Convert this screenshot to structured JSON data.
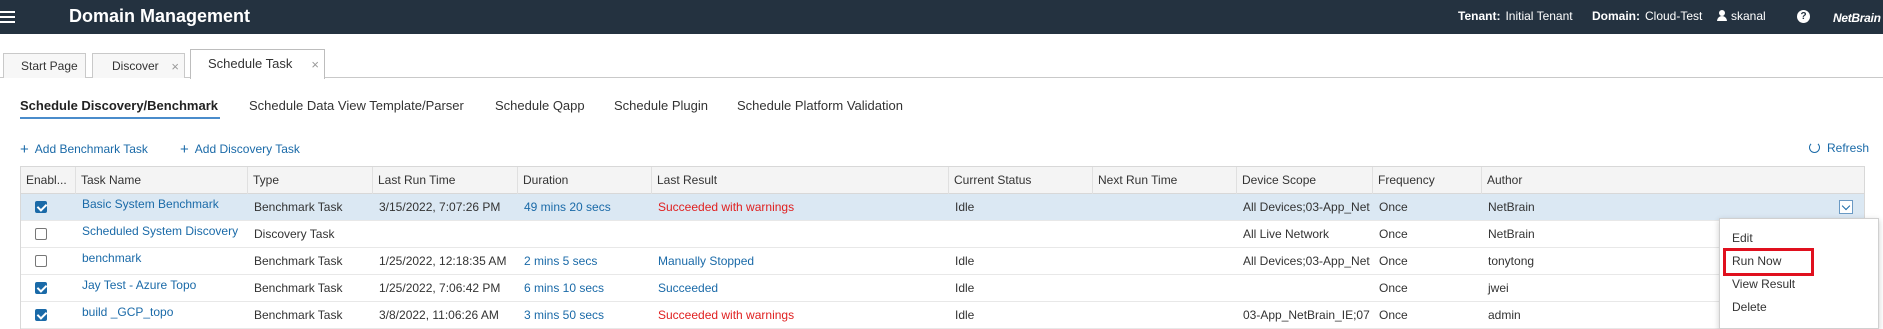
{
  "topbar": {
    "title": "Domain Management",
    "tenant_label": "Tenant:",
    "tenant_value": "Initial Tenant",
    "domain_label": "Domain:",
    "domain_value": "Cloud-Test",
    "user": "skanal",
    "help": "?",
    "logo": "NetBrain"
  },
  "page_tabs": [
    {
      "label": "Start Page"
    },
    {
      "label": "Discover",
      "close": "×"
    },
    {
      "label": "Schedule Task",
      "close": "×",
      "active": true
    }
  ],
  "sub_tabs": [
    {
      "label": "Schedule Discovery/Benchmark",
      "active": true
    },
    {
      "label": "Schedule Data View Template/Parser"
    },
    {
      "label": "Schedule Qapp"
    },
    {
      "label": "Schedule Plugin"
    },
    {
      "label": "Schedule Platform Validation"
    }
  ],
  "actions": {
    "add_benchmark": "Add Benchmark Task",
    "add_discovery": "Add Discovery Task",
    "plus": "+",
    "refresh": "Refresh"
  },
  "grid": {
    "columns": [
      "Enabl...",
      "Task Name",
      "Type",
      "Last Run Time",
      "Duration",
      "Last Result",
      "Current Status",
      "Next Run Time",
      "Device Scope",
      "Frequency",
      "Author"
    ],
    "rows": [
      {
        "enabled": true,
        "name": "Basic System Benchmark",
        "type": "Benchmark Task",
        "last_run": "3/15/2022, 7:07:26 PM",
        "duration": "49 mins 20 secs",
        "result": "Succeeded with warnings",
        "status": "Idle",
        "next_run": "",
        "scope": "All Devices;03-App_Net...",
        "frequency": "Once",
        "author": "NetBrain"
      },
      {
        "enabled": false,
        "name": "Scheduled System Discovery",
        "type": "Discovery Task",
        "last_run": "",
        "duration": "",
        "result": "",
        "status": "",
        "next_run": "",
        "scope": "All Live Network",
        "frequency": "Once",
        "author": "NetBrain"
      },
      {
        "enabled": false,
        "name": "benchmark",
        "type": "Benchmark Task",
        "last_run": "1/25/2022, 12:18:35 AM",
        "duration": "2 mins 5 secs",
        "result": "Manually Stopped",
        "status": "Idle",
        "next_run": "",
        "scope": "All Devices;03-App_Net...",
        "frequency": "Once",
        "author": "tonytong"
      },
      {
        "enabled": true,
        "name": "Jay Test - Azure Topo",
        "type": "Benchmark Task",
        "last_run": "1/25/2022, 7:06:42 PM",
        "duration": "6 mins 10 secs",
        "result": "Succeeded",
        "status": "Idle",
        "next_run": "",
        "scope": "",
        "frequency": "Once",
        "author": "jwei"
      },
      {
        "enabled": true,
        "name": "build _GCP_topo",
        "type": "Benchmark Task",
        "last_run": "3/8/2022, 11:06:26 AM",
        "duration": "3 mins 50 secs",
        "result": "Succeeded with warnings",
        "status": "Idle",
        "next_run": "",
        "scope": "03-App_NetBrain_IE;07...",
        "frequency": "Once",
        "author": "admin"
      }
    ]
  },
  "context_menu": {
    "items": [
      "Edit",
      "Run Now",
      "View Result",
      "Delete"
    ],
    "highlighted": "Run Now"
  },
  "colors": {
    "topbar": "#243240",
    "link": "#1a6aa8",
    "warning": "#e02020",
    "selected_row": "#dbe8f3",
    "highlight_box": "#e0101e"
  }
}
